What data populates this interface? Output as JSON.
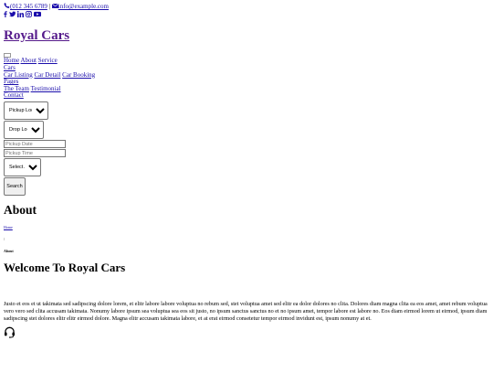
{
  "topbar": {
    "phone": "(012 345 6789",
    "divider": "|",
    "email": "info@example.com"
  },
  "social": {
    "icons": [
      "facebook-icon",
      "twitter-icon",
      "linkedin-icon",
      "instagram-icon",
      "youtube-icon"
    ]
  },
  "brand": {
    "name": "Royal Cars"
  },
  "nav": {
    "home": "Home",
    "about": "About",
    "service": "Service",
    "cars": "Cars",
    "car_listing": "Car Listing",
    "car_detail": "Car Detail",
    "car_booking": "Car Booking",
    "pages": "Pages",
    "the_team": "The Team",
    "testimonial": "Testimonial",
    "contact": "Contact"
  },
  "search_form": {
    "pickup_location": "Pickup Location",
    "drop_location": "Drop Location",
    "pickup_date_placeholder": "Pickup Date",
    "pickup_time_placeholder": "Pickup Time",
    "select_car": "Select A Car",
    "search_button": "Search"
  },
  "page_header": {
    "title": "About",
    "breadcrumb_home": "Home",
    "breadcrumb_sep": "/",
    "breadcrumb_current": "About"
  },
  "about_section": {
    "heading": "Welcome To Royal Cars",
    "paragraph": "Justo et eos et ut takimata sed sadipscing dolore lorem, et elitr labore labore voluptua no rebum sed, stet voluptua amet sed elitr ea dolor dolores no clita. Dolores diam magna clita ea eos amet, amet rebum voluptua vero vero sed clita accusam takimata. Nonumy labore ipsum sea voluptua sea eos sit justo, no ipsum sanctus sanctus no et no ipsum amet, tempor labore est labore no. Eos diam eirmod lorem ut eirmod, ipsum diam sadipscing stet dolores elitr elitr eirmod dolore. Magna elitr accusam takimata labore, et at erat eirmod consetetur tempor eirmod invidunt est, ipsum nonumy at et."
  },
  "colors": {
    "link": "#1a0dab",
    "visited_link": "#551a8b"
  }
}
